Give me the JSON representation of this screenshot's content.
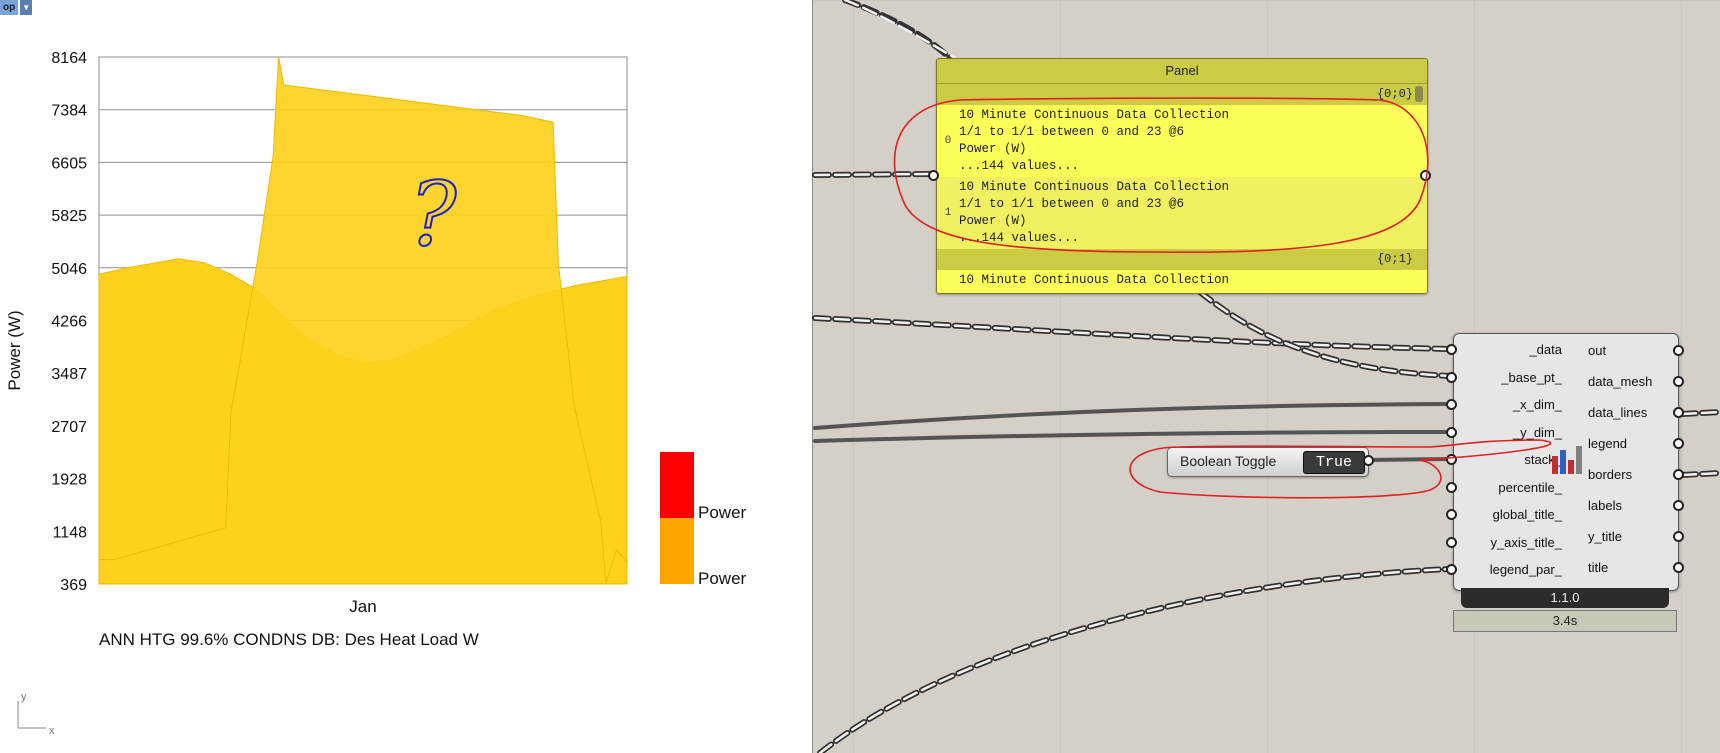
{
  "viewport": {
    "tab_name": "op",
    "axis_gizmo": {
      "y": "y",
      "x": "x"
    }
  },
  "chart_data": {
    "type": "area",
    "ylabel": "Power (W)",
    "categories": [
      "Jan"
    ],
    "y_ticks": [
      "8164",
      "7384",
      "6605",
      "5825",
      "5046",
      "4266",
      "3487",
      "2707",
      "1928",
      "1148",
      "369"
    ],
    "ylim": [
      369,
      8164
    ],
    "caption": "ANN HTG 99.6% CONDNS DB: Des Heat Load W",
    "legend": [
      {
        "name": "Power",
        "color": "#ff0000"
      },
      {
        "name": "Power",
        "color": "#ffa500"
      }
    ],
    "series": [
      {
        "name": "Power",
        "x": [
          0,
          5,
          10,
          15,
          20,
          25,
          30,
          35,
          40,
          45,
          50,
          55,
          60,
          65,
          70,
          75,
          80,
          85,
          90,
          95,
          100
        ],
        "values": [
          4950,
          5040,
          5110,
          5180,
          5120,
          4950,
          4720,
          4320,
          3980,
          3760,
          3650,
          3670,
          3820,
          4000,
          4210,
          4420,
          4560,
          4680,
          4780,
          4850,
          4920
        ]
      },
      {
        "name": "Power",
        "x": [
          0,
          3,
          24,
          25,
          30,
          33,
          34,
          35,
          40,
          50,
          60,
          70,
          80,
          86,
          87,
          90,
          95,
          96,
          98,
          100
        ],
        "values": [
          730,
          730,
          1200,
          2900,
          5150,
          6700,
          8164,
          7750,
          7700,
          7600,
          7500,
          7400,
          7300,
          7200,
          5100,
          3000,
          1300,
          380,
          870,
          700
        ]
      }
    ],
    "annotation_symbol": "?"
  },
  "canvas": {
    "panel": {
      "title": "Panel",
      "branches": [
        "{0;0}",
        "{0;1}"
      ],
      "entries": [
        {
          "index": "0",
          "lines": [
            "10 Minute Continuous Data Collection",
            "1/1 to 1/1 between 0 and 23 @6",
            "Power (W)",
            "...144 values..."
          ]
        },
        {
          "index": "1",
          "lines": [
            "10 Minute Continuous Data Collection",
            "1/1 to 1/1 between 0 and 23 @6",
            "Power (W)",
            "...144 values..."
          ]
        }
      ],
      "overflow_line": "10 Minute Continuous Data Collection"
    },
    "component": {
      "inputs": [
        "_data",
        "_base_pt_",
        "_x_dim_",
        "_y_dim_",
        "stack_",
        "percentile_",
        "global_title_",
        "y_axis_title_",
        "legend_par_"
      ],
      "outputs": [
        "out",
        "data_mesh",
        "data_lines",
        "legend",
        "borders",
        "labels",
        "y_title",
        "title"
      ],
      "version": "1.1.0",
      "runtime": "3.4s"
    },
    "toggle": {
      "label": "Boolean Toggle",
      "value": "True"
    }
  }
}
